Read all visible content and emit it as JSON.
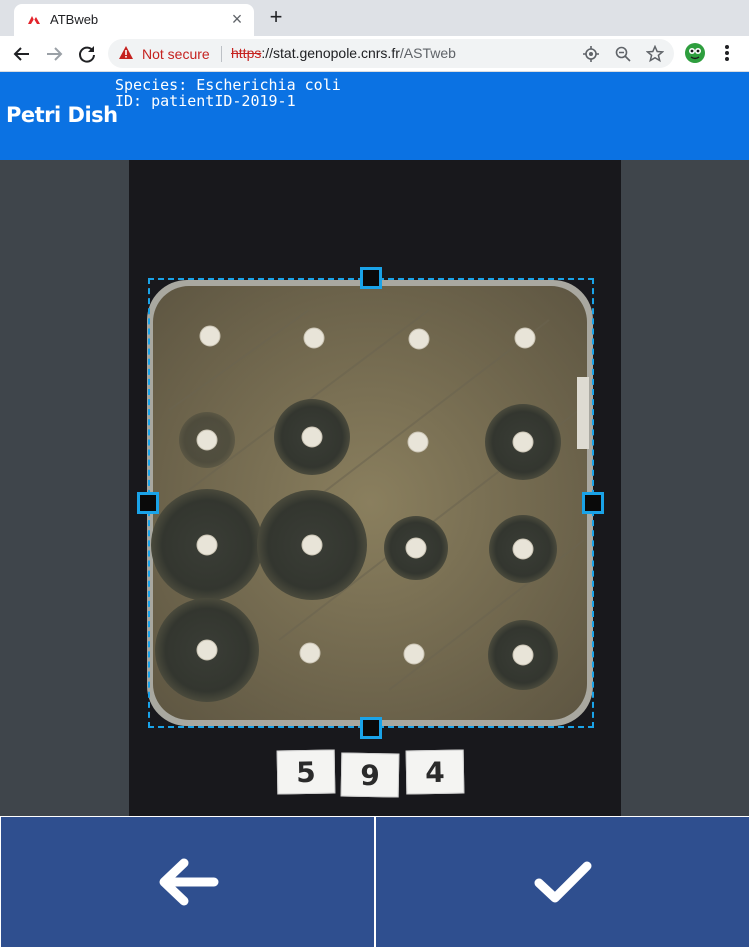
{
  "browser": {
    "tab_title": "ATBweb",
    "tab_favicon": "msf-logo-icon",
    "security_label": "Not secure",
    "url_protocol": "https",
    "url_host": "://stat.genopole.cnrs.fr",
    "url_path": "/ASTweb",
    "icons": [
      "back-arrow-icon",
      "forward-arrow-icon",
      "reload-icon",
      "warning-icon",
      "location-icon",
      "zoom-out-icon",
      "bookmark-star-icon",
      "extension-icon",
      "menu-dots-icon"
    ]
  },
  "header": {
    "title": "Petri Dish",
    "species_line": "Species: Escherichia coli",
    "id_line": "ID: patientID-2019-1",
    "color": "#0b72e3"
  },
  "plate": {
    "label_digits": [
      "5",
      "9",
      "4"
    ],
    "crop_color": "#1aa3e8"
  },
  "actions": {
    "back_icon": "arrow-left-icon",
    "confirm_icon": "checkmark-icon",
    "color": "#2f4f8f"
  }
}
